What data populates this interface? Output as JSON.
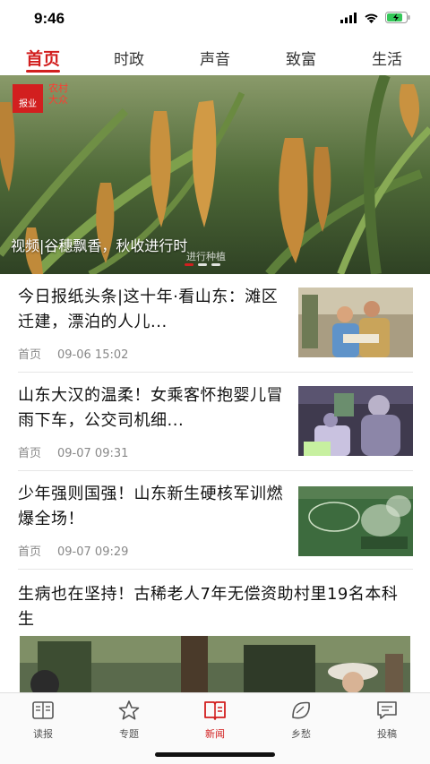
{
  "status": {
    "time": "9:46"
  },
  "tabs": [
    {
      "label": "首页",
      "active": true
    },
    {
      "label": "时政"
    },
    {
      "label": "声音"
    },
    {
      "label": "致富"
    },
    {
      "label": "生活"
    }
  ],
  "hero": {
    "logo": "报业",
    "logo_sub": "农村大众",
    "caption": "视频|谷穗飘香，秋收进行时",
    "caption_sub": "进行种植",
    "slides": 3,
    "active_slide": 1
  },
  "news": [
    {
      "title": "今日报纸头条|这十年·看山东：滩区迁建，漂泊的人儿...",
      "channel": "首页",
      "time": "09-06 15:02"
    },
    {
      "title": "山东大汉的温柔！女乘客怀抱婴儿冒雨下车，公交司机细...",
      "channel": "首页",
      "time": "09-07 09:31"
    },
    {
      "title": "少年强则国强！山东新生硬核军训燃爆全场！",
      "channel": "首页",
      "time": "09-07 09:29"
    }
  ],
  "wide_news": {
    "title": "生病也在坚持！古稀老人7年无偿资助村里19名本科生"
  },
  "bottom_nav": [
    {
      "label": "读报",
      "icon": "newspaper-icon"
    },
    {
      "label": "专题",
      "icon": "star-icon"
    },
    {
      "label": "新闻",
      "icon": "book-icon",
      "active": true
    },
    {
      "label": "乡愁",
      "icon": "leaf-icon"
    },
    {
      "label": "投稿",
      "icon": "message-icon"
    }
  ],
  "colors": {
    "accent": "#d21f1f"
  }
}
